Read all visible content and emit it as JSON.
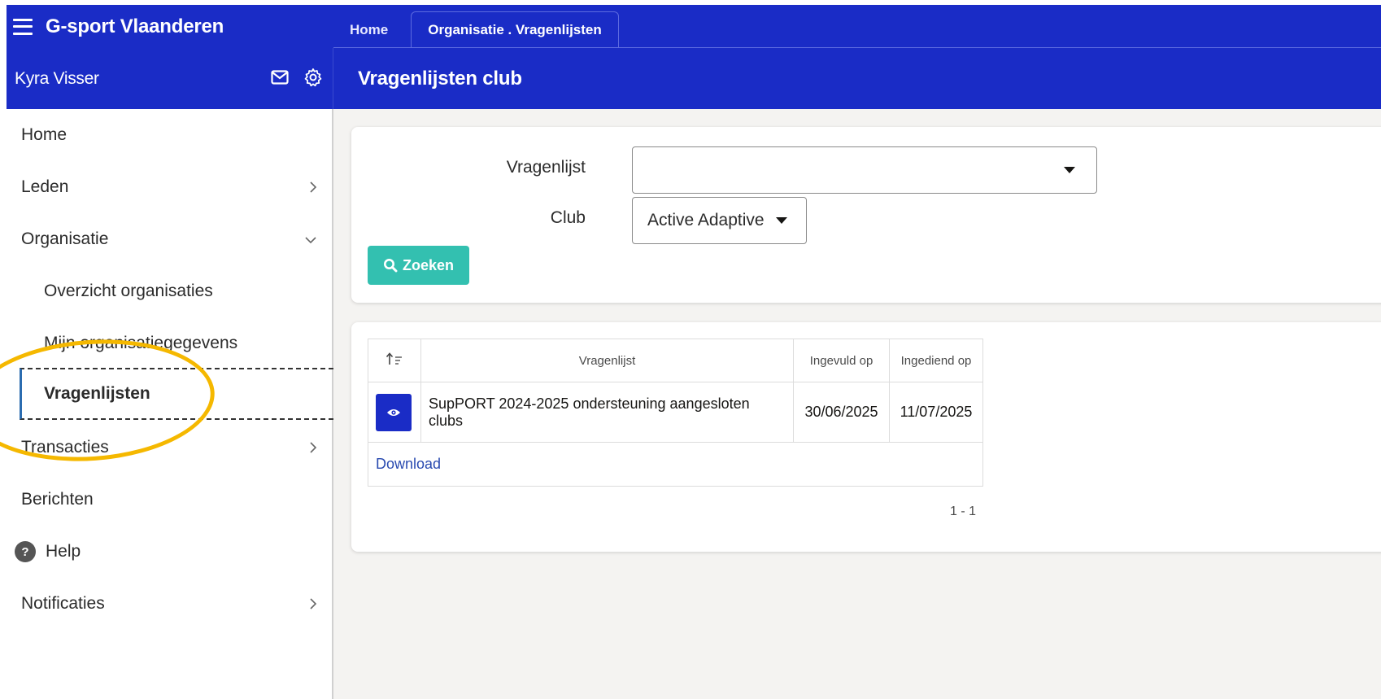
{
  "app": {
    "title": "G-sport Vlaanderen",
    "user": "Kyra Visser",
    "page_title": "Vragenlijsten club"
  },
  "tabs": [
    {
      "label": "Home",
      "active": false
    },
    {
      "label": "Organisatie . Vragenlijsten",
      "active": true
    }
  ],
  "sidebar": {
    "items": [
      {
        "label": "Home"
      },
      {
        "label": "Leden"
      },
      {
        "label": "Organisatie"
      },
      {
        "label": "Overzicht organisaties"
      },
      {
        "label": "Mijn organisatiegegevens"
      },
      {
        "label": "Vragenlijsten"
      },
      {
        "label": "Transacties"
      },
      {
        "label": "Berichten"
      },
      {
        "label": "Help"
      },
      {
        "label": "Notificaties"
      }
    ]
  },
  "search": {
    "vragenlijst_label": "Vragenlijst",
    "vragenlijst_value": "",
    "club_label": "Club",
    "club_value": "Active Adaptive",
    "button_label": "Zoeken"
  },
  "results": {
    "columns": [
      "Vragenlijst",
      "Ingevuld op",
      "Ingediend op"
    ],
    "rows": [
      {
        "vragenlijst": "SupPORT 2024-2025 ondersteuning aangesloten clubs",
        "ingevuld_op": "30/06/2025",
        "ingediend_op": "11/07/2025"
      }
    ],
    "download_label": "Download",
    "pagination": "1 - 1"
  },
  "colors": {
    "header_blue": "#1a2cc6",
    "button_teal": "#33c0b0",
    "highlight_yellow": "#f5b800"
  },
  "icons": {
    "menu": "hamburger-icon",
    "mail": "mail-icon",
    "settings": "gear-icon",
    "sort": "sort-icon",
    "view": "eye-icon",
    "search": "search-icon",
    "help": "help-icon"
  }
}
